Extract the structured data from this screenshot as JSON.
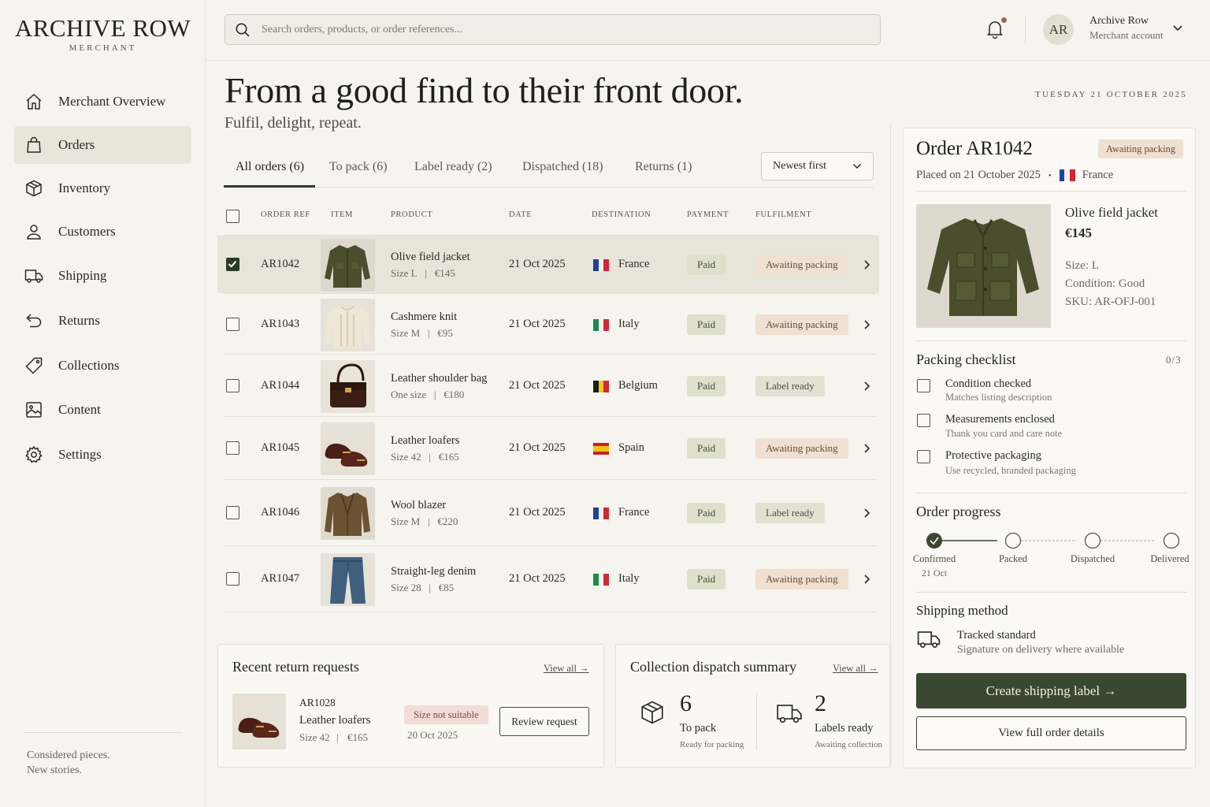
{
  "brand": {
    "name": "ARCHIVE ROW",
    "subtitle": "MERCHANT"
  },
  "sidebar": {
    "items": [
      {
        "label": "Merchant Overview",
        "icon": "home-icon",
        "active": false
      },
      {
        "label": "Orders",
        "icon": "shopping-bag-icon",
        "active": true
      },
      {
        "label": "Inventory",
        "icon": "box-icon",
        "active": false
      },
      {
        "label": "Customers",
        "icon": "user-icon",
        "active": false
      },
      {
        "label": "Shipping",
        "icon": "truck-icon",
        "active": false
      },
      {
        "label": "Returns",
        "icon": "return-arrow-icon",
        "active": false
      },
      {
        "label": "Collections",
        "icon": "tag-icon",
        "active": false
      },
      {
        "label": "Content",
        "icon": "image-icon",
        "active": false
      },
      {
        "label": "Settings",
        "icon": "gear-icon",
        "active": false
      }
    ],
    "footer_line1": "Considered pieces.",
    "footer_line2": "New stories."
  },
  "search": {
    "placeholder": "Search orders, products, or order references..."
  },
  "account": {
    "initials": "AR",
    "name": "Archive Row",
    "subtitle": "Merchant account"
  },
  "hero": {
    "title": "From a good find to their front door.",
    "subtitle": "Fulfil, delight, repeat."
  },
  "date_label": "TUESDAY 21 OCTOBER 2025",
  "tabs": [
    "All orders (6)",
    "To pack (6)",
    "Label ready (2)",
    "Dispatched (18)",
    "Returns (1)"
  ],
  "sort": {
    "value": "Newest first"
  },
  "table": {
    "columns": [
      "ORDER REF",
      "ITEM",
      "PRODUCT",
      "DATE",
      "DESTINATION",
      "PAYMENT",
      "FULFILMENT"
    ],
    "rows": [
      {
        "ref": "AR1042",
        "product": "Olive field jacket",
        "size": "Size L",
        "price": "€145",
        "date": "21 Oct 2025",
        "destination": "France",
        "flag": [
          "#1f3f99",
          "#f4f2ee",
          "#d22630"
        ],
        "flag_dir": "v",
        "payment": "Paid",
        "fulfilment": "Awaiting packing",
        "fulfil_kind": "await",
        "checked": true,
        "thumb": "jacket"
      },
      {
        "ref": "AR1043",
        "product": "Cashmere knit",
        "size": "Size M",
        "price": "€95",
        "date": "21 Oct 2025",
        "destination": "Italy",
        "flag": [
          "#1e8a4c",
          "#f4f2ee",
          "#cf2b37"
        ],
        "flag_dir": "v",
        "payment": "Paid",
        "fulfilment": "Awaiting packing",
        "fulfil_kind": "await",
        "checked": false,
        "thumb": "knit"
      },
      {
        "ref": "AR1044",
        "product": "Leather shoulder bag",
        "size": "One size",
        "price": "€180",
        "date": "21 Oct 2025",
        "destination": "Belgium",
        "flag": [
          "#1b1b1b",
          "#f2c61f",
          "#d8262f"
        ],
        "flag_dir": "v",
        "payment": "Paid",
        "fulfilment": "Label ready",
        "fulfil_kind": "label",
        "checked": false,
        "thumb": "bag"
      },
      {
        "ref": "AR1045",
        "product": "Leather loafers",
        "size": "Size 42",
        "price": "€165",
        "date": "21 Oct 2025",
        "destination": "Spain",
        "flag": [
          "#c8202a",
          "#f2c21b",
          "#c8202a"
        ],
        "flag_dir": "h",
        "payment": "Paid",
        "fulfilment": "Awaiting packing",
        "fulfil_kind": "await",
        "checked": false,
        "thumb": "loafers"
      },
      {
        "ref": "AR1046",
        "product": "Wool blazer",
        "size": "Size M",
        "price": "€220",
        "date": "21 Oct 2025",
        "destination": "France",
        "flag": [
          "#1f3f99",
          "#f4f2ee",
          "#d22630"
        ],
        "flag_dir": "v",
        "payment": "Paid",
        "fulfilment": "Label ready",
        "fulfil_kind": "label",
        "checked": false,
        "thumb": "blazer"
      },
      {
        "ref": "AR1047",
        "product": "Straight-leg denim",
        "size": "Size 28",
        "price": "€85",
        "date": "21 Oct 2025",
        "destination": "Italy",
        "flag": [
          "#1e8a4c",
          "#f4f2ee",
          "#cf2b37"
        ],
        "flag_dir": "v",
        "payment": "Paid",
        "fulfilment": "Awaiting packing",
        "fulfil_kind": "await",
        "checked": false,
        "thumb": "denim"
      }
    ]
  },
  "returns": {
    "title": "Recent return requests",
    "view_all": "View all →",
    "item": {
      "ref": "AR1028",
      "product": "Leather loafers",
      "size": "Size 42",
      "price": "€165",
      "reason": "Size not suitable",
      "date": "20 Oct 2025",
      "action": "Review request"
    }
  },
  "dispatch": {
    "title": "Collection dispatch summary",
    "view_all": "View all →",
    "stats": [
      {
        "number": "6",
        "label": "To pack",
        "sub": "Ready for packing",
        "icon": "package-icon"
      },
      {
        "number": "2",
        "label": "Labels ready",
        "sub": "Awaiting collection",
        "icon": "truck-icon"
      }
    ]
  },
  "order_panel": {
    "title": "Order AR1042",
    "status": "Awaiting packing",
    "placed": "Placed on 21 October 2025",
    "separator": "•",
    "country": "France",
    "product": "Olive field jacket",
    "price": "€145",
    "size": "Size: L",
    "condition": "Condition: Good",
    "sku": "SKU: AR-OFJ-001",
    "checklist_title": "Packing checklist",
    "checklist_count": "0/3",
    "checklist": [
      {
        "title": "Condition checked",
        "sub": "Matches listing description"
      },
      {
        "title": "Measurements enclosed",
        "sub": "Thank you card and care note"
      },
      {
        "title": "Protective packaging",
        "sub": "Use recycled, branded packaging"
      }
    ],
    "progress_title": "Order progress",
    "progress": [
      {
        "label": "Confirmed",
        "date": "21 Oct",
        "done": true
      },
      {
        "label": "Packed",
        "date": "",
        "done": false
      },
      {
        "label": "Dispatched",
        "date": "",
        "done": false
      },
      {
        "label": "Delivered",
        "date": "",
        "done": false
      }
    ],
    "shipping_title": "Shipping method",
    "shipping_name": "Tracked standard",
    "shipping_sub": "Signature on delivery where available",
    "primary_button": "Create shipping label →",
    "secondary_button": "View full order details"
  },
  "colors": {
    "accent": "#3a4731",
    "background": "#f6f4ee",
    "await_pill": "#efe0d2",
    "paid_pill": "#dfe0cc"
  }
}
